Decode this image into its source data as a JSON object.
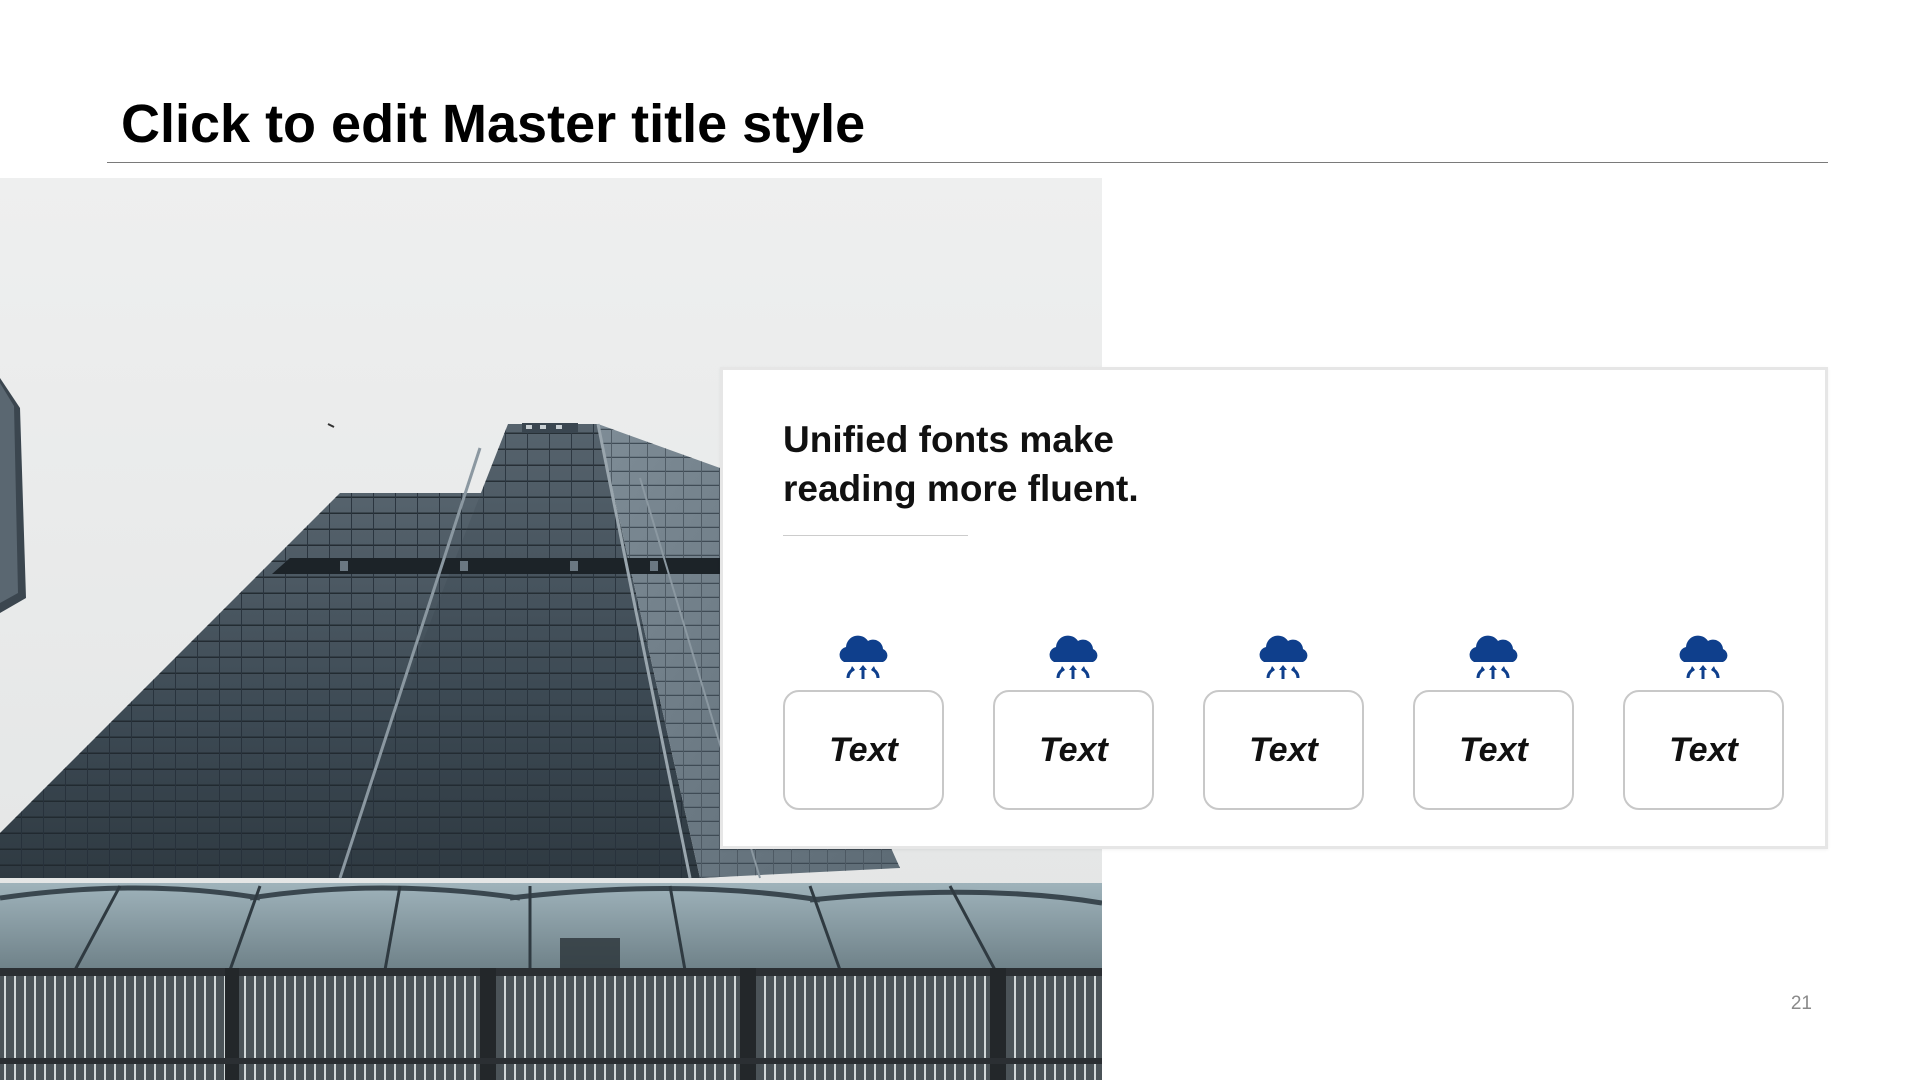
{
  "slide": {
    "title": "Click to edit Master title style",
    "page_number": "21"
  },
  "photo": {
    "subject": "low-angle view of glass skyscraper",
    "colors": {
      "sky": "#e9eaea",
      "building": "#3f4d59",
      "building_light": "#7f8e99",
      "glass_roof": "#8fa4ad",
      "railing": "#2b2f33"
    }
  },
  "card": {
    "heading": "Unified fonts make reading more fluent.",
    "items": [
      {
        "icon": "cloud-transfer-icon",
        "label": "Text"
      },
      {
        "icon": "cloud-transfer-icon",
        "label": "Text"
      },
      {
        "icon": "cloud-transfer-icon",
        "label": "Text"
      },
      {
        "icon": "cloud-transfer-icon",
        "label": "Text"
      },
      {
        "icon": "cloud-transfer-icon",
        "label": "Text"
      }
    ]
  },
  "colors": {
    "accent": "#0f3f8c",
    "box_border": "#c8c8c8",
    "rule": "#7a7a7a"
  }
}
